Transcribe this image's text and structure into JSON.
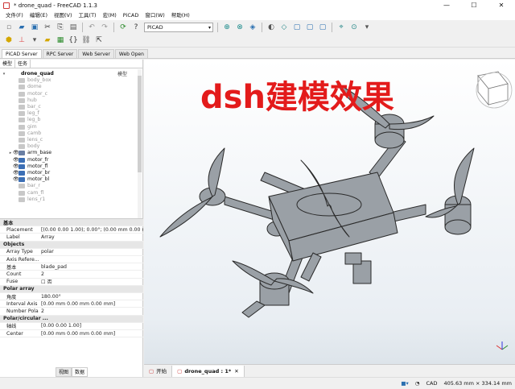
{
  "window": {
    "title": "* drone_quad - FreeCAD 1.1.3",
    "minimize": "—",
    "maximize": "☐",
    "close": "✕"
  },
  "menu": [
    "文件(F)",
    "编辑(E)",
    "视图(V)",
    "工具(T)",
    "宏(M)",
    "PiCAD",
    "窗口(W)",
    "帮助(H)"
  ],
  "toolbar": {
    "workbench": "PiCAD"
  },
  "server_tabs": [
    "PiCAD Server",
    "RPC Server",
    "Web Server",
    "Web Open"
  ],
  "panel_tabs": [
    "模型",
    "任务"
  ],
  "tree": {
    "header": "模型",
    "items": [
      {
        "label": "drone_quad",
        "type": "root"
      },
      {
        "label": "body_box",
        "type": "grey"
      },
      {
        "label": "dome",
        "type": "grey"
      },
      {
        "label": "motor_c",
        "type": "grey"
      },
      {
        "label": "hub",
        "type": "grey"
      },
      {
        "label": "bar_c",
        "type": "grey"
      },
      {
        "label": "leg_f",
        "type": "grey"
      },
      {
        "label": "leg_b",
        "type": "grey"
      },
      {
        "label": "gim",
        "type": "grey"
      },
      {
        "label": "camb",
        "type": "grey"
      },
      {
        "label": "lens_c",
        "type": "grey"
      },
      {
        "label": "body",
        "type": "grey"
      },
      {
        "label": "arm_base",
        "type": "shade"
      },
      {
        "label": "motor_fr",
        "type": "blue"
      },
      {
        "label": "motor_fl",
        "type": "blue"
      },
      {
        "label": "motor_br",
        "type": "blue"
      },
      {
        "label": "motor_bl",
        "type": "blue"
      },
      {
        "label": "bar_r",
        "type": "grey"
      },
      {
        "label": "cam_fl",
        "type": "grey"
      },
      {
        "label": "lens_r1",
        "type": "grey"
      }
    ]
  },
  "properties": [
    {
      "group": "基本"
    },
    {
      "name": "Placement",
      "value": "[(0.00 0.00 1.00); 0.00°; (0.00 mm  0.00 mm"
    },
    {
      "name": "Label",
      "value": "Array"
    },
    {
      "group": "Objects"
    },
    {
      "name": "Array Type",
      "value": "polar"
    },
    {
      "name": "Axis Refere...",
      "value": ""
    },
    {
      "name": "基本",
      "value": "blade_pad"
    },
    {
      "name": "Count",
      "value": "2"
    },
    {
      "name": "Fuse",
      "value": "☐ 否"
    },
    {
      "group": "Polar array"
    },
    {
      "name": "角度",
      "value": "180.00°"
    },
    {
      "name": "Interval Axis",
      "value": "[0.00 mm 0.00 mm 0.00 mm]"
    },
    {
      "name": "Number Polar",
      "value": "2"
    },
    {
      "group": "Polar/circular ..."
    },
    {
      "name": "轴线",
      "value": "[0.00 0.00 1.00]"
    },
    {
      "name": "Center",
      "value": "[0.00 mm 0.00 mm 0.00 mm]"
    }
  ],
  "bottom_tabs": [
    "视图",
    "数据"
  ],
  "overlay": "dsh建模效果",
  "view_tabs": [
    "开始",
    "drone_quad : 1*"
  ],
  "status": {
    "nav": "CAD",
    "dims": "405.63 mm × 334.14 mm"
  },
  "colors": {
    "overlay": "#e31b1b",
    "model": "#9aa0a6"
  }
}
